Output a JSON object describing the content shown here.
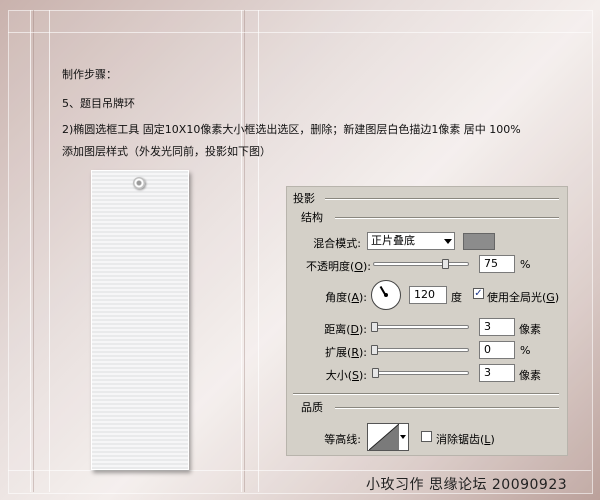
{
  "tutorial": {
    "line1": "制作步骤：",
    "line2": "5、题目吊牌环",
    "line3": "2)椭圆选框工具 固定10X10像素大小框选出选区，删除；新建图层白色描边1像素 居中 100%",
    "line4": "添加图层样式（外发光同前，投影如下图）"
  },
  "panel": {
    "title": "投影",
    "structure": {
      "title": "结构",
      "blend_mode_label": "混合模式:",
      "blend_mode_value": "正片叠底",
      "blend_color": "#8c8c8c",
      "opacity_label": "不透明度",
      "opacity_key": "O",
      "opacity_value": "75",
      "opacity_unit": "%",
      "opacity_fraction": 0.75,
      "angle_label": "角度",
      "angle_key": "A",
      "angle_value": "120",
      "angle_unit": "度",
      "angle_degrees": 120,
      "global_light_label": "使用全局光",
      "global_light_key": "G",
      "global_light_checked": true,
      "distance_label": "距离",
      "distance_key": "D",
      "distance_value": "3",
      "distance_unit": "像素",
      "spread_label": "扩展",
      "spread_key": "R",
      "spread_value": "0",
      "spread_unit": "%",
      "size_label": "大小",
      "size_key": "S",
      "size_value": "3",
      "size_unit": "像素"
    },
    "quality": {
      "title": "品质",
      "contour_label": "等高线:",
      "antialias_label": "消除锯齿",
      "antialias_key": "L",
      "antialias_checked": false
    }
  },
  "watermark": "小玫习作 思缘论坛 20090923"
}
